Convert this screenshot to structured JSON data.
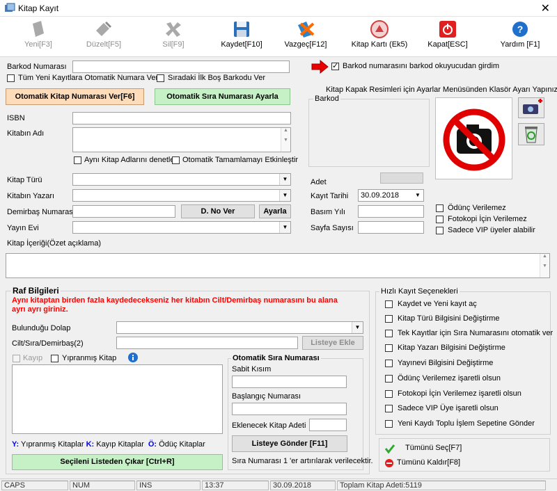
{
  "window": {
    "title": "Kitap Kayıt"
  },
  "toolbar": {
    "new_label": "Yeni[F3]",
    "edit_label": "Düzelt[F5]",
    "delete_label": "Sil[F9]",
    "save_label": "Kaydet[F10]",
    "cancel_label": "Vazgeç[F12]",
    "card_label": "Kitap Kartı (Ek5)",
    "close_label": "Kapat[ESC]",
    "help_label": "Yardım [F1]"
  },
  "form": {
    "barcode_label": "Barkod Numarası",
    "barcode_value": "",
    "auto_number_all_label": "Tüm Yeni Kayıtlara Otomatik Numara Ver",
    "next_empty_barcode_label": "Sıradaki İlk Boş Barkodu Ver",
    "auto_book_number_button": "Otomatik Kitap Numarası Ver[F6]",
    "auto_sequence_button": "Otomatik Sıra Numarası Ayarla",
    "isbn_label": "ISBN",
    "title_label": "Kitabın Adı",
    "check_same_title_label": "Aynı Kitap Adlarını denetle",
    "autocomplete_label": "Otomatik Tamamlamayı Etkinleştir",
    "book_type_label": "Kitap Türü",
    "author_label": "Kitabın Yazarı",
    "inventory_label": "Demirbaş Numarası",
    "d_no_button": "D. No Ver",
    "adjust_button": "Ayarla",
    "publisher_label": "Yayın Evi",
    "content_label": "Kitap İçeriği(Özet açıklama)"
  },
  "right": {
    "barcode_reader_label": "Barkod numarasını barkod okuyucudan girdim",
    "barcode_reader_checked": true,
    "cover_hint": "Kitap Kapak Resimleri için Ayarlar Menüsünden Klasör Ayarı Yapınız",
    "barcode_group": "Barkod",
    "count_label": "Adet",
    "date_label": "Kayıt Tarihi",
    "date_value": "30.09.2018",
    "print_year_label": "Basım Yılı",
    "pages_label": "Sayfa Sayısı",
    "no_lend_label": "Ödünç Verilemez",
    "no_copy_label": "Fotokopi İçin Verilemez",
    "vip_label": "Sadece VIP üyeler alabilir"
  },
  "shelf": {
    "title": "Raf Bilgileri",
    "warning": "Aynı kitaptan birden fazla kaydedecekseniz her kitabın Cilt/Demirbaş numarasını bu alana ayrı ayrı giriniz.",
    "cabinet_label": "Bulunduğu Dolap",
    "volume_label": "Cilt/Sıra/Demirbaş(2)",
    "add_list_button": "Listeye Ekle",
    "lost_label": "Kayıp",
    "worn_label": "Yıpranmış Kitap",
    "legend_y_key": "Y:",
    "legend_y": "Yıpranmış Kitaplar",
    "legend_k_key": "K:",
    "legend_k": "Kayıp Kitaplar",
    "legend_o_key": "Ö:",
    "legend_o": "Ödüç Kitaplar",
    "remove_selected_button": "Seçileni Listeden Çıkar [Ctrl+R]"
  },
  "auto_seq": {
    "title": "Otomatik Sıra Numarası",
    "fixed_label": "Sabit Kısım",
    "start_label": "Başlangıç Numarası",
    "count_label": "Eklenecek Kitap Adeti",
    "send_button": "Listeye Gönder [F11]",
    "note": "Sıra Numarası 1 'er artırılarak verilecektir."
  },
  "quick": {
    "title": "Hızlı Kayıt Seçenekleri",
    "options": [
      "Kaydet ve Yeni kayıt aç",
      "Kitap Türü Bilgisini Değiştirme",
      "Tek Kayıtlar için Sıra Numarasını otomatik ver",
      "Kitap Yazarı Bilgisini Değiştirme",
      "Yayınevi Bilgisini Değiştirme",
      "Ödünç Verilemez işaretli olsun",
      "Fotokopi İçin Verilemez işaretli olsun",
      "Sadece VIP Üye  işaretli olsun",
      "Yeni Kaydı Toplu İşlem Sepetine Gönder"
    ],
    "select_all": "Tümünü Seç[F7]",
    "remove_all": "Tümünü Kaldır[F8]"
  },
  "status": {
    "caps": "CAPS",
    "num": "NUM",
    "ins": "INS",
    "time": "13:37",
    "date": "30.09.2018",
    "total": "Toplam Kitap Adeti:5119"
  },
  "colors": {
    "warning_red": "#ff0000",
    "legend_blue": "#0000ff",
    "green_button": "#c6f0c6",
    "peach_button": "#ffdcb9"
  }
}
